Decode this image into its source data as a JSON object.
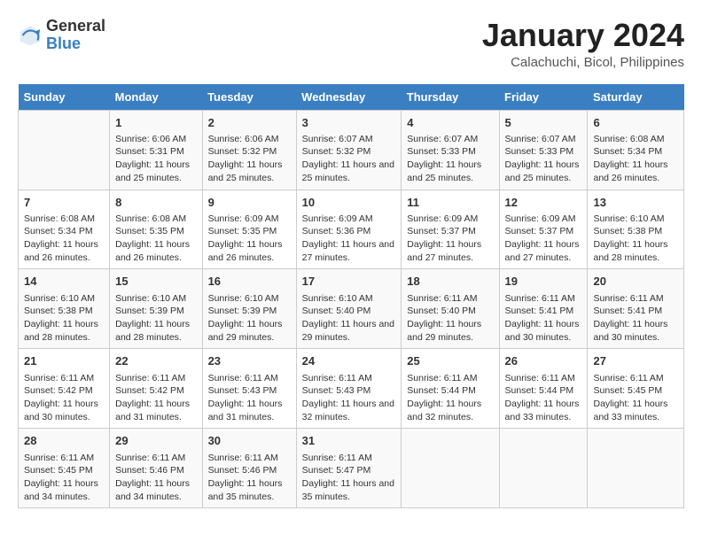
{
  "logo": {
    "general": "General",
    "blue": "Blue"
  },
  "header": {
    "month": "January 2024",
    "location": "Calachuchi, Bicol, Philippines"
  },
  "weekdays": [
    "Sunday",
    "Monday",
    "Tuesday",
    "Wednesday",
    "Thursday",
    "Friday",
    "Saturday"
  ],
  "weeks": [
    [
      {
        "day": "",
        "sunrise": "",
        "sunset": "",
        "daylight": ""
      },
      {
        "day": "1",
        "sunrise": "Sunrise: 6:06 AM",
        "sunset": "Sunset: 5:31 PM",
        "daylight": "Daylight: 11 hours and 25 minutes."
      },
      {
        "day": "2",
        "sunrise": "Sunrise: 6:06 AM",
        "sunset": "Sunset: 5:32 PM",
        "daylight": "Daylight: 11 hours and 25 minutes."
      },
      {
        "day": "3",
        "sunrise": "Sunrise: 6:07 AM",
        "sunset": "Sunset: 5:32 PM",
        "daylight": "Daylight: 11 hours and 25 minutes."
      },
      {
        "day": "4",
        "sunrise": "Sunrise: 6:07 AM",
        "sunset": "Sunset: 5:33 PM",
        "daylight": "Daylight: 11 hours and 25 minutes."
      },
      {
        "day": "5",
        "sunrise": "Sunrise: 6:07 AM",
        "sunset": "Sunset: 5:33 PM",
        "daylight": "Daylight: 11 hours and 25 minutes."
      },
      {
        "day": "6",
        "sunrise": "Sunrise: 6:08 AM",
        "sunset": "Sunset: 5:34 PM",
        "daylight": "Daylight: 11 hours and 26 minutes."
      }
    ],
    [
      {
        "day": "7",
        "sunrise": "Sunrise: 6:08 AM",
        "sunset": "Sunset: 5:34 PM",
        "daylight": "Daylight: 11 hours and 26 minutes."
      },
      {
        "day": "8",
        "sunrise": "Sunrise: 6:08 AM",
        "sunset": "Sunset: 5:35 PM",
        "daylight": "Daylight: 11 hours and 26 minutes."
      },
      {
        "day": "9",
        "sunrise": "Sunrise: 6:09 AM",
        "sunset": "Sunset: 5:35 PM",
        "daylight": "Daylight: 11 hours and 26 minutes."
      },
      {
        "day": "10",
        "sunrise": "Sunrise: 6:09 AM",
        "sunset": "Sunset: 5:36 PM",
        "daylight": "Daylight: 11 hours and 27 minutes."
      },
      {
        "day": "11",
        "sunrise": "Sunrise: 6:09 AM",
        "sunset": "Sunset: 5:37 PM",
        "daylight": "Daylight: 11 hours and 27 minutes."
      },
      {
        "day": "12",
        "sunrise": "Sunrise: 6:09 AM",
        "sunset": "Sunset: 5:37 PM",
        "daylight": "Daylight: 11 hours and 27 minutes."
      },
      {
        "day": "13",
        "sunrise": "Sunrise: 6:10 AM",
        "sunset": "Sunset: 5:38 PM",
        "daylight": "Daylight: 11 hours and 28 minutes."
      }
    ],
    [
      {
        "day": "14",
        "sunrise": "Sunrise: 6:10 AM",
        "sunset": "Sunset: 5:38 PM",
        "daylight": "Daylight: 11 hours and 28 minutes."
      },
      {
        "day": "15",
        "sunrise": "Sunrise: 6:10 AM",
        "sunset": "Sunset: 5:39 PM",
        "daylight": "Daylight: 11 hours and 28 minutes."
      },
      {
        "day": "16",
        "sunrise": "Sunrise: 6:10 AM",
        "sunset": "Sunset: 5:39 PM",
        "daylight": "Daylight: 11 hours and 29 minutes."
      },
      {
        "day": "17",
        "sunrise": "Sunrise: 6:10 AM",
        "sunset": "Sunset: 5:40 PM",
        "daylight": "Daylight: 11 hours and 29 minutes."
      },
      {
        "day": "18",
        "sunrise": "Sunrise: 6:11 AM",
        "sunset": "Sunset: 5:40 PM",
        "daylight": "Daylight: 11 hours and 29 minutes."
      },
      {
        "day": "19",
        "sunrise": "Sunrise: 6:11 AM",
        "sunset": "Sunset: 5:41 PM",
        "daylight": "Daylight: 11 hours and 30 minutes."
      },
      {
        "day": "20",
        "sunrise": "Sunrise: 6:11 AM",
        "sunset": "Sunset: 5:41 PM",
        "daylight": "Daylight: 11 hours and 30 minutes."
      }
    ],
    [
      {
        "day": "21",
        "sunrise": "Sunrise: 6:11 AM",
        "sunset": "Sunset: 5:42 PM",
        "daylight": "Daylight: 11 hours and 30 minutes."
      },
      {
        "day": "22",
        "sunrise": "Sunrise: 6:11 AM",
        "sunset": "Sunset: 5:42 PM",
        "daylight": "Daylight: 11 hours and 31 minutes."
      },
      {
        "day": "23",
        "sunrise": "Sunrise: 6:11 AM",
        "sunset": "Sunset: 5:43 PM",
        "daylight": "Daylight: 11 hours and 31 minutes."
      },
      {
        "day": "24",
        "sunrise": "Sunrise: 6:11 AM",
        "sunset": "Sunset: 5:43 PM",
        "daylight": "Daylight: 11 hours and 32 minutes."
      },
      {
        "day": "25",
        "sunrise": "Sunrise: 6:11 AM",
        "sunset": "Sunset: 5:44 PM",
        "daylight": "Daylight: 11 hours and 32 minutes."
      },
      {
        "day": "26",
        "sunrise": "Sunrise: 6:11 AM",
        "sunset": "Sunset: 5:44 PM",
        "daylight": "Daylight: 11 hours and 33 minutes."
      },
      {
        "day": "27",
        "sunrise": "Sunrise: 6:11 AM",
        "sunset": "Sunset: 5:45 PM",
        "daylight": "Daylight: 11 hours and 33 minutes."
      }
    ],
    [
      {
        "day": "28",
        "sunrise": "Sunrise: 6:11 AM",
        "sunset": "Sunset: 5:45 PM",
        "daylight": "Daylight: 11 hours and 34 minutes."
      },
      {
        "day": "29",
        "sunrise": "Sunrise: 6:11 AM",
        "sunset": "Sunset: 5:46 PM",
        "daylight": "Daylight: 11 hours and 34 minutes."
      },
      {
        "day": "30",
        "sunrise": "Sunrise: 6:11 AM",
        "sunset": "Sunset: 5:46 PM",
        "daylight": "Daylight: 11 hours and 35 minutes."
      },
      {
        "day": "31",
        "sunrise": "Sunrise: 6:11 AM",
        "sunset": "Sunset: 5:47 PM",
        "daylight": "Daylight: 11 hours and 35 minutes."
      },
      {
        "day": "",
        "sunrise": "",
        "sunset": "",
        "daylight": ""
      },
      {
        "day": "",
        "sunrise": "",
        "sunset": "",
        "daylight": ""
      },
      {
        "day": "",
        "sunrise": "",
        "sunset": "",
        "daylight": ""
      }
    ]
  ]
}
